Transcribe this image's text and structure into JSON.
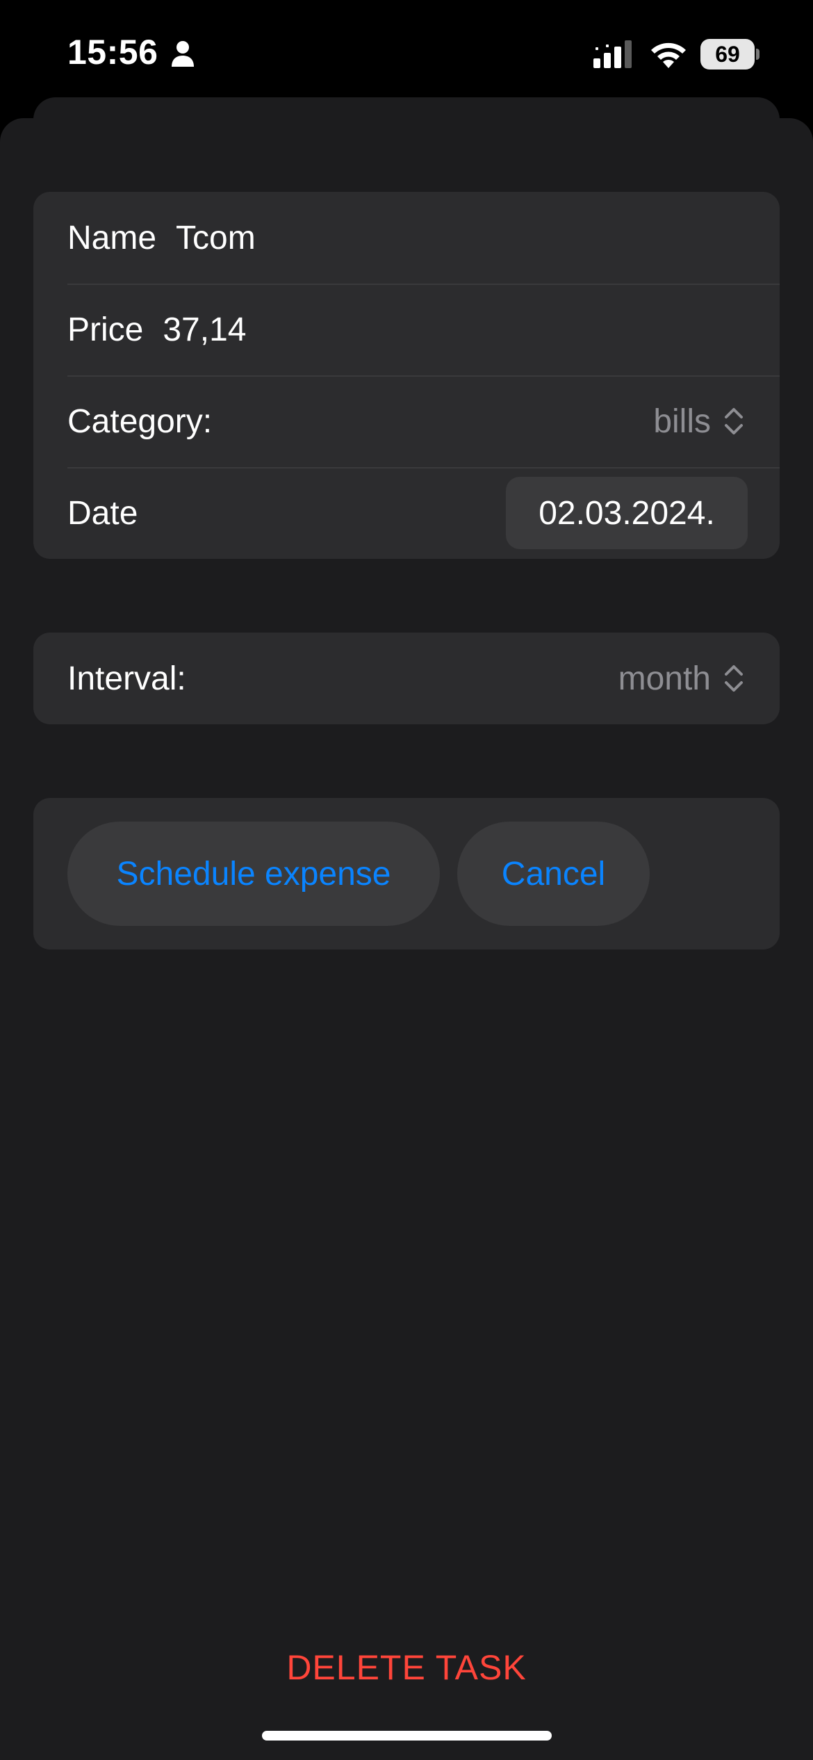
{
  "status_bar": {
    "time": "15:56",
    "battery": "69",
    "icons": [
      "person-icon",
      "signal-icon",
      "wifi-icon",
      "battery-icon"
    ]
  },
  "form": {
    "name": {
      "label": "Name",
      "value": "Tcom"
    },
    "price": {
      "label": "Price",
      "value": "37,14"
    },
    "category": {
      "label": "Category:",
      "value": "bills"
    },
    "date": {
      "label": "Date",
      "value": "02.03.2024."
    },
    "interval": {
      "label": "Interval:",
      "value": "month"
    }
  },
  "actions": {
    "schedule_label": "Schedule expense",
    "cancel_label": "Cancel",
    "delete_label": "DELETE TASK"
  },
  "colors": {
    "accent": "#0a84ff",
    "destructive": "#ff453a",
    "sheet_bg": "#1c1c1e",
    "group_bg": "#2c2c2e",
    "secondary_text": "#8e8e93"
  }
}
